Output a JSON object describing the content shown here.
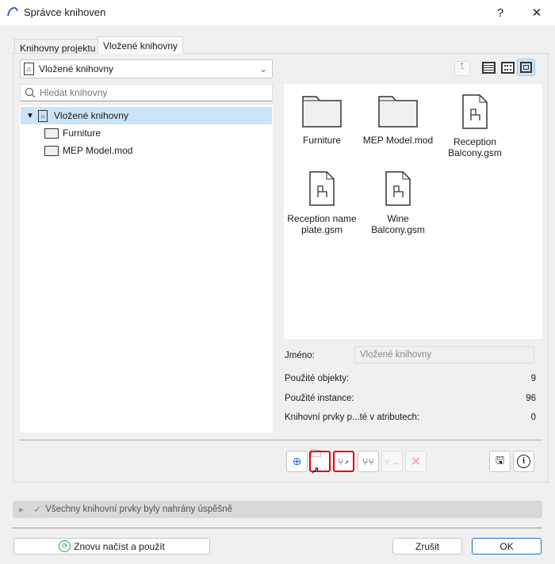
{
  "window": {
    "title": "Správce knihoven",
    "help": "?",
    "close": "✕"
  },
  "tabs": [
    {
      "label": "Knihovny projektu",
      "active": false
    },
    {
      "label": "Vložené knihovny",
      "active": true
    }
  ],
  "library_select": {
    "value": "Vložené knihovny"
  },
  "search": {
    "placeholder": "Hledat knihovny",
    "value": ""
  },
  "tree": {
    "root": "Vložené knihovny",
    "children": [
      "Furniture",
      "MEP Model.mod"
    ]
  },
  "view_modes": [
    "list",
    "small-icons",
    "large-icons"
  ],
  "active_view": "large-icons",
  "items": [
    {
      "label": "Furniture",
      "type": "folder"
    },
    {
      "label": "MEP Model.mod",
      "type": "folder"
    },
    {
      "label": "Reception Balcony.gsm",
      "type": "object"
    },
    {
      "label": "Reception name plate.gsm",
      "type": "object"
    },
    {
      "label": "Wine Balcony.gsm",
      "type": "object"
    }
  ],
  "properties": {
    "name_label": "Jméno:",
    "name_value": "Vložené knihovny",
    "rows": [
      {
        "label": "Použité objekty:",
        "value": "9"
      },
      {
        "label": "Použité instance:",
        "value": "96"
      },
      {
        "label": "Knihovní prvky p...té v atributech:",
        "value": "0"
      }
    ]
  },
  "status": {
    "text": "Všechny knihovní prvky byly nahrány úspěšně"
  },
  "buttons": {
    "reload": "Znovu načíst a použít",
    "cancel": "Zrušit",
    "ok": "OK"
  }
}
